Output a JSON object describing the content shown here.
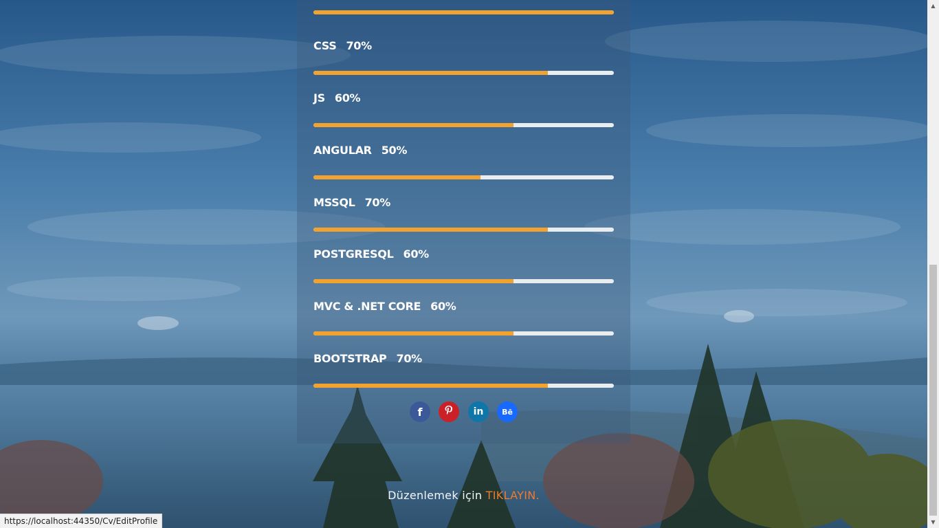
{
  "skills": [
    {
      "name": "CSS",
      "percent_label": "70%",
      "level": 0.78
    },
    {
      "name": "JS",
      "percent_label": "60%",
      "level": 0.665
    },
    {
      "name": "ANGULAR",
      "percent_label": "50%",
      "level": 0.555
    },
    {
      "name": "MSSQL",
      "percent_label": "70%",
      "level": 0.78
    },
    {
      "name": "POSTGRESQL",
      "percent_label": "60%",
      "level": 0.665
    },
    {
      "name": "MVC & .NET CORE",
      "percent_label": "60%",
      "level": 0.665
    },
    {
      "name": "BOOTSTRAP",
      "percent_label": "70%",
      "level": 0.78
    }
  ],
  "top_bar_level": 1.0,
  "social": [
    {
      "icon": "facebook-icon",
      "glyph": "f",
      "color": "#3b5998"
    },
    {
      "icon": "pinterest-icon",
      "glyph": "P",
      "color": "#cb2027"
    },
    {
      "icon": "linkedin-icon",
      "glyph": "in",
      "color": "#0e76a8"
    },
    {
      "icon": "behance-icon",
      "glyph": "Bē",
      "color": "#1769ff"
    }
  ],
  "footer": {
    "text": "Düzenlemek için ",
    "link_label": "TIKLAYIN."
  },
  "status_bar": {
    "url": "https://localhost:44350/Cv/EditProfile"
  },
  "colors": {
    "bar_fill": "#f2a22f",
    "bar_track": "#e9edf0",
    "link_accent": "#f07a2e"
  }
}
